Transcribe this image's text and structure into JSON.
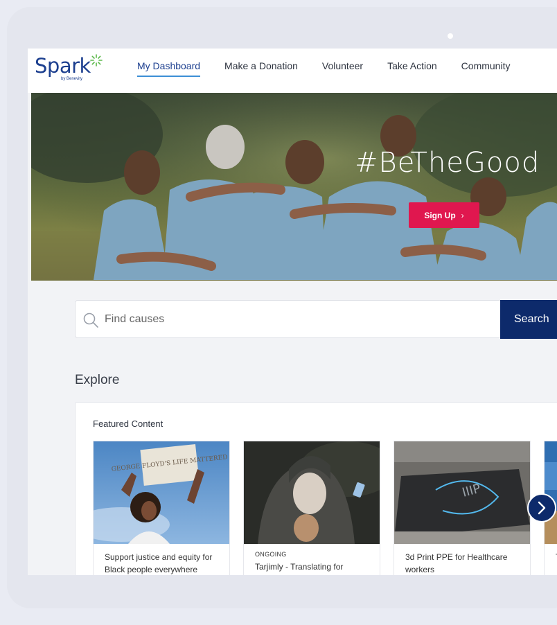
{
  "logo": {
    "word": "Spark",
    "sub": "by Benevity"
  },
  "nav": {
    "links": [
      "My Dashboard",
      "Make a Donation",
      "Volunteer",
      "Take Action",
      "Community"
    ]
  },
  "hero": {
    "title": "#BeTheGood",
    "button": "Sign Up",
    "button_chevron": "›"
  },
  "search": {
    "placeholder": "Find causes",
    "button": "Search"
  },
  "explore": {
    "heading": "Explore"
  },
  "featured": {
    "title": "Featured Content",
    "cards": [
      {
        "tag": "",
        "text": "Support justice and equity for Black people everywhere",
        "sign_text": "GEORGE FLOYD'S LIFE MATTERED"
      },
      {
        "tag": "ONGOING",
        "text": "Tarjimly - Translating for"
      },
      {
        "tag": "",
        "text": "3d Print PPE for Healthcare workers",
        "screen_text": "IIIP"
      },
      {
        "tag": "",
        "text": "T D"
      }
    ]
  },
  "colors": {
    "brand": "#1c3f8f",
    "accent": "#e0174f",
    "search_button": "#0d2a6b",
    "active_underline": "#3c8fd6"
  },
  "icons": [
    "search-icon",
    "chevron-right-icon",
    "spark-logo-icon"
  ]
}
